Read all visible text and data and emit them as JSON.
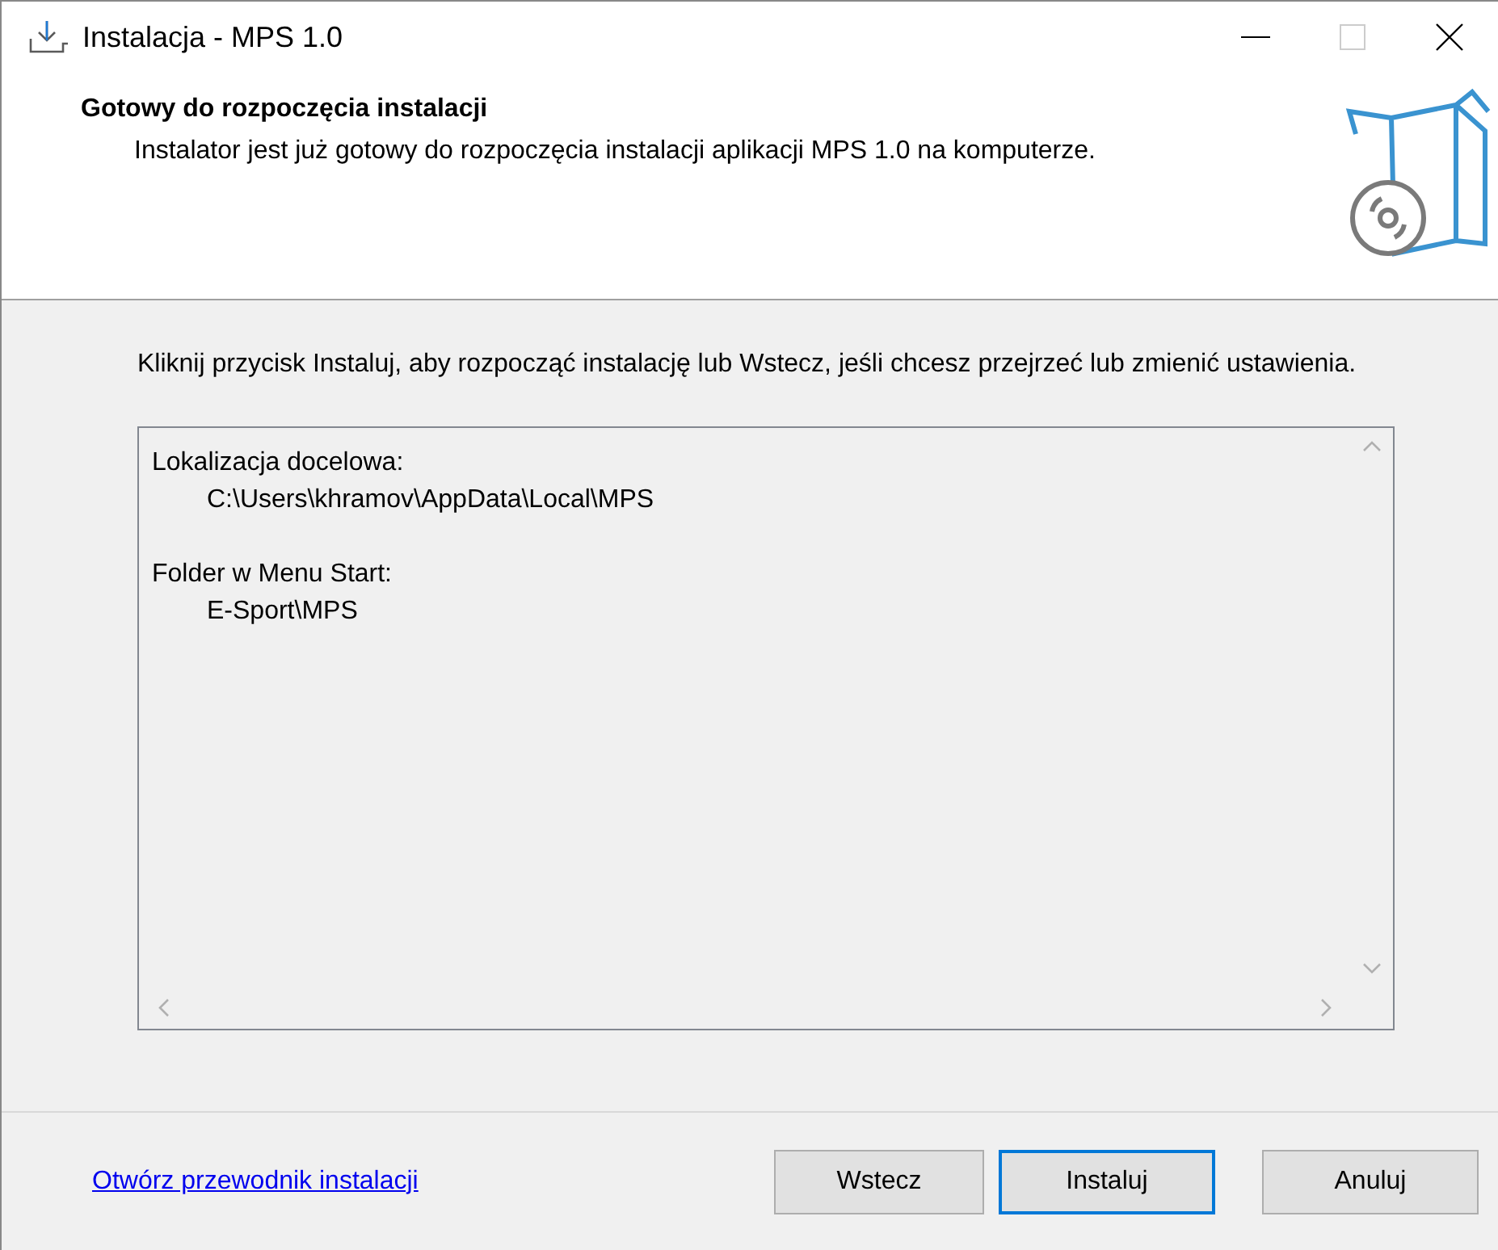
{
  "window": {
    "title": "Instalacja - MPS 1.0"
  },
  "header": {
    "title": "Gotowy do rozpoczęcia instalacji",
    "subtitle": "Instalator jest już gotowy do rozpoczęcia instalacji aplikacji MPS 1.0 na komputerze."
  },
  "instruction": "Kliknij przycisk Instaluj, aby rozpocząć instalację lub Wstecz, jeśli chcesz przejrzeć lub zmienić ustawienia.",
  "summary": [
    {
      "label": "Lokalizacja docelowa:",
      "value": "C:\\Users\\khramov\\AppData\\Local\\MPS"
    },
    {
      "label": "Folder w Menu Start:",
      "value": "E-Sport\\MPS"
    }
  ],
  "help_link": "Otwórz przewodnik instalacji",
  "buttons": [
    {
      "label": "Wstecz",
      "selected": false
    },
    {
      "label": "Instaluj",
      "selected": true
    },
    {
      "label": "Anuluj",
      "selected": false
    }
  ]
}
